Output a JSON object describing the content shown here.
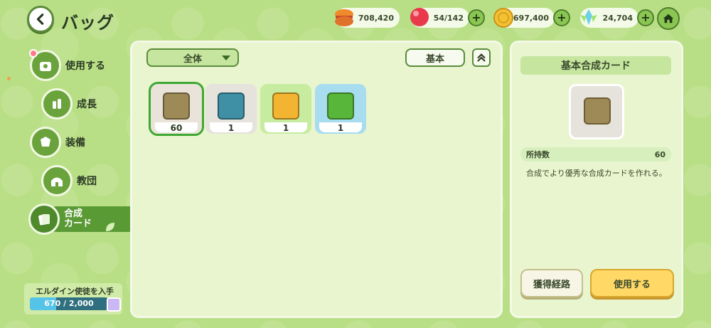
{
  "header": {
    "title": "バッグ",
    "currencies": [
      {
        "icon": "macaron-icon",
        "value": "708,420"
      },
      {
        "icon": "red-gem-icon",
        "value": "54/142"
      },
      {
        "icon": "gold-coin-icon",
        "value": "697,400"
      },
      {
        "icon": "crystal-flower-icon",
        "value": "24,704"
      }
    ]
  },
  "sidebar": {
    "items": [
      {
        "label": "使用する",
        "icon": "bag-icon"
      },
      {
        "label": "成長",
        "icon": "growth-icon"
      },
      {
        "label": "装備",
        "icon": "equipment-icon"
      },
      {
        "label": "教団",
        "icon": "church-icon"
      },
      {
        "label": "合成\nカード",
        "icon": "card-icon"
      }
    ],
    "quest": {
      "label": "エルダイン使徒を入手",
      "progress_text": "670 / 2,000",
      "progress_value": 670,
      "progress_max": 2000
    }
  },
  "main": {
    "filter_label": "全体",
    "sort_label": "基本",
    "items": [
      {
        "count": "60",
        "bg": "#e9e3da",
        "card": "#9e8a56",
        "selected": true
      },
      {
        "count": "1",
        "bg": "#e6e2dc",
        "card": "#3f8fa5",
        "selected": false
      },
      {
        "count": "1",
        "bg": "#c7ec9f",
        "card": "#f2b431",
        "selected": false
      },
      {
        "count": "1",
        "bg": "#a8dcef",
        "card": "#58b73a",
        "selected": false
      }
    ]
  },
  "detail": {
    "title": "基本合成カード",
    "owned_label": "所持数",
    "owned_value": "60",
    "description": "合成でより優秀な合成カードを作れる。",
    "route_button": "獲得経路",
    "use_button": "使用する"
  },
  "colors": {
    "background": "#b9df86",
    "panel": "#e8f5cf",
    "accent_green": "#5a9a35",
    "use_yellow": "#ffd866"
  }
}
